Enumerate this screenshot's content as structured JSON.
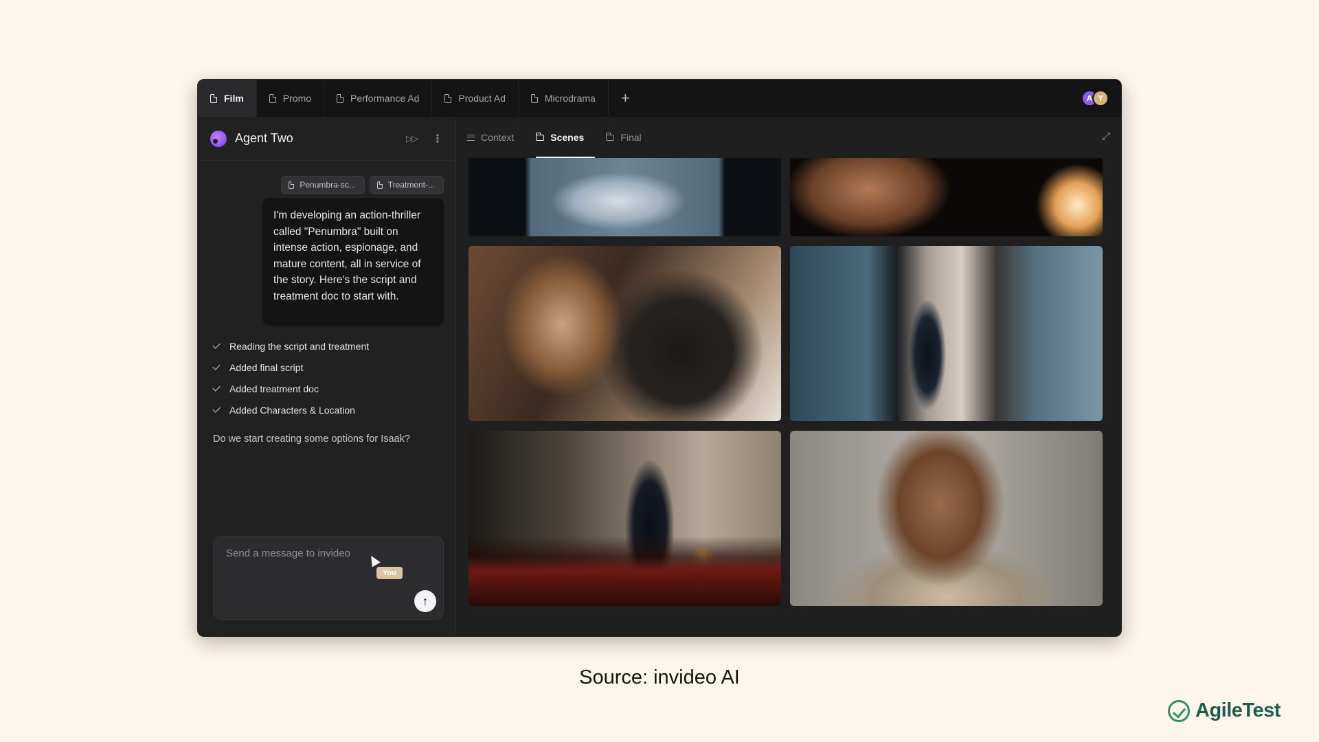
{
  "tabs": [
    {
      "label": "Film",
      "active": true
    },
    {
      "label": "Promo",
      "active": false
    },
    {
      "label": "Performance Ad",
      "active": false
    },
    {
      "label": "Product Ad",
      "active": false
    },
    {
      "label": "Microdrama",
      "active": false
    }
  ],
  "tab_add_label": "+",
  "avatars": [
    "A",
    "Y"
  ],
  "agent": {
    "name": "Agent Two",
    "action_icon": "fast-forward-icon",
    "more_icon": "more-vertical-icon"
  },
  "attachments": [
    "Penumbra-sc...",
    "Treatment-..."
  ],
  "user_message": "I'm developing an action-thriller called \"Penumbra\" built on intense action, espionage, and mature content, all in service of the story. Here's the script and treatment doc to start with.",
  "steps": [
    "Reading the script and treatment",
    "Added final script",
    "Added treatment doc",
    "Added Characters & Location"
  ],
  "agent_question": "Do we start creating some options for Isaak?",
  "composer": {
    "placeholder": "Send a message to invideo",
    "cursor_label": "You",
    "send_icon": "arrow-up-icon"
  },
  "subtabs": [
    {
      "label": "Context",
      "icon": "lines-icon",
      "active": false
    },
    {
      "label": "Scenes",
      "icon": "folder-icon",
      "active": true
    },
    {
      "label": "Final",
      "icon": "folder-icon",
      "active": false
    }
  ],
  "caption": "Source: invideo AI",
  "brand": "AgileTest",
  "colors": {
    "page_bg": "#fdf6ea",
    "window_bg": "#1e1e1f",
    "brand_green": "#2f8f6a",
    "accent_purple": "#8b5cf6"
  }
}
